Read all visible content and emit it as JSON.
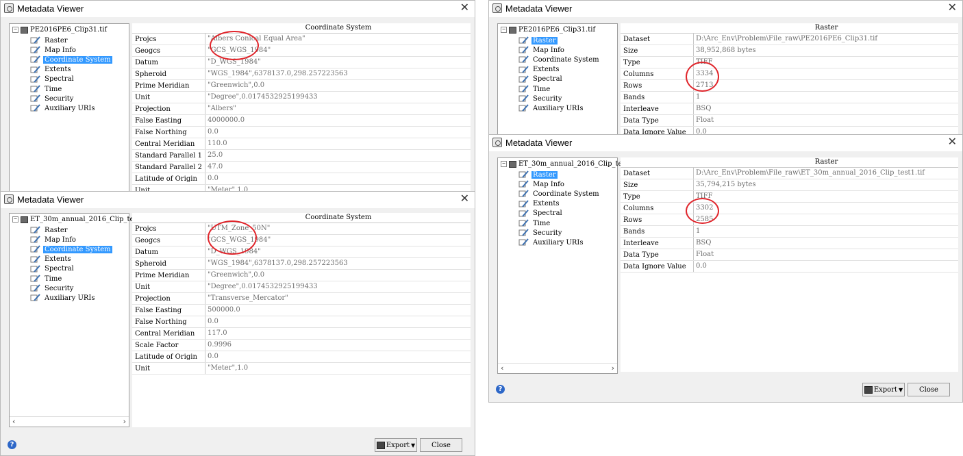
{
  "windows": [
    {
      "title": "Metadata Viewer",
      "file": "PE2016PE6_Clip31.tif",
      "tree_items": [
        "Raster",
        "Map Info",
        "Coordinate System",
        "Extents",
        "Spectral",
        "Time",
        "Security",
        "Auxiliary URIs"
      ],
      "selected": "Coordinate System",
      "header": "Coordinate System",
      "rows": [
        {
          "k": "Projcs",
          "v": "\"Albers Conical Equal Area\""
        },
        {
          "k": "Geogcs",
          "v": "\"GCS_WGS_1984\""
        },
        {
          "k": "Datum",
          "v": "\"D_WGS_1984\""
        },
        {
          "k": "Spheroid",
          "v": "\"WGS_1984\",6378137.0,298.257223563"
        },
        {
          "k": "Prime Meridian",
          "v": "\"Greenwich\",0.0"
        },
        {
          "k": "Unit",
          "v": "\"Degree\",0.0174532925199433"
        },
        {
          "k": "Projection",
          "v": "\"Albers\""
        },
        {
          "k": "False Easting",
          "v": "4000000.0"
        },
        {
          "k": "False Northing",
          "v": "0.0"
        },
        {
          "k": "Central Meridian",
          "v": "110.0"
        },
        {
          "k": "Standard Parallel 1",
          "v": "25.0"
        },
        {
          "k": "Standard Parallel 2",
          "v": "47.0"
        },
        {
          "k": "Latitude of Origin",
          "v": "0.0"
        },
        {
          "k": "Unit",
          "v": "\"Meter\",1.0"
        }
      ]
    },
    {
      "title": "Metadata Viewer",
      "file": "ET_30m_annual_2016_Clip_te",
      "tree_items": [
        "Raster",
        "Map Info",
        "Coordinate System",
        "Extents",
        "Spectral",
        "Time",
        "Security",
        "Auxiliary URIs"
      ],
      "selected": "Coordinate System",
      "header": "Coordinate System",
      "rows": [
        {
          "k": "Projcs",
          "v": "\"UTM_Zone_50N\""
        },
        {
          "k": "Geogcs",
          "v": "\"GCS_WGS_1984\""
        },
        {
          "k": "Datum",
          "v": "\"D_WGS_1984\""
        },
        {
          "k": "Spheroid",
          "v": "\"WGS_1984\",6378137.0,298.257223563"
        },
        {
          "k": "Prime Meridian",
          "v": "\"Greenwich\",0.0"
        },
        {
          "k": "Unit",
          "v": "\"Degree\",0.0174532925199433"
        },
        {
          "k": "Projection",
          "v": "\"Transverse_Mercator\""
        },
        {
          "k": "False Easting",
          "v": "500000.0"
        },
        {
          "k": "False Northing",
          "v": "0.0"
        },
        {
          "k": "Central Meridian",
          "v": "117.0"
        },
        {
          "k": "Scale Factor",
          "v": "0.9996"
        },
        {
          "k": "Latitude of Origin",
          "v": "0.0"
        },
        {
          "k": "Unit",
          "v": "\"Meter\",1.0"
        }
      ],
      "export_label": "Export",
      "close_label": "Close"
    },
    {
      "title": "Metadata Viewer",
      "file": "PE2016PE6_Clip31.tif",
      "tree_items": [
        "Raster",
        "Map Info",
        "Coordinate System",
        "Extents",
        "Spectral",
        "Time",
        "Security",
        "Auxiliary URIs"
      ],
      "selected": "Raster",
      "header": "Raster",
      "rows": [
        {
          "k": "Dataset",
          "v": "D:\\Arc_Env\\Problem\\File_raw\\PE2016PE6_Clip31.tif"
        },
        {
          "k": "Size",
          "v": "38,952,868 bytes"
        },
        {
          "k": "Type",
          "v": "TIFF"
        },
        {
          "k": "Columns",
          "v": "3334"
        },
        {
          "k": "Rows",
          "v": "2713"
        },
        {
          "k": "Bands",
          "v": "1"
        },
        {
          "k": "Interleave",
          "v": "BSQ"
        },
        {
          "k": "Data Type",
          "v": "Float"
        },
        {
          "k": "Data Ignore Value",
          "v": "0.0"
        }
      ]
    },
    {
      "title": "Metadata Viewer",
      "file": "ET_30m_annual_2016_Clip_te",
      "tree_items": [
        "Raster",
        "Map Info",
        "Coordinate System",
        "Extents",
        "Spectral",
        "Time",
        "Security",
        "Auxiliary URIs"
      ],
      "selected": "Raster",
      "header": "Raster",
      "rows": [
        {
          "k": "Dataset",
          "v": "D:\\Arc_Env\\Problem\\File_raw\\ET_30m_annual_2016_Clip_test1.tif"
        },
        {
          "k": "Size",
          "v": "35,794,215 bytes"
        },
        {
          "k": "Type",
          "v": "TIFF"
        },
        {
          "k": "Columns",
          "v": "3302"
        },
        {
          "k": "Rows",
          "v": "2585"
        },
        {
          "k": "Bands",
          "v": "1"
        },
        {
          "k": "Interleave",
          "v": "BSQ"
        },
        {
          "k": "Data Type",
          "v": "Float"
        },
        {
          "k": "Data Ignore Value",
          "v": "0.0"
        }
      ],
      "export_label": "Export",
      "close_label": "Close"
    }
  ],
  "icons": {
    "close": "close-x-icon",
    "help": "help-icon",
    "export": "floppy-disk-icon",
    "tree_item": "pencil-page-icon"
  },
  "accent_color": "#3399ff",
  "annotation_color": "#e0252b"
}
